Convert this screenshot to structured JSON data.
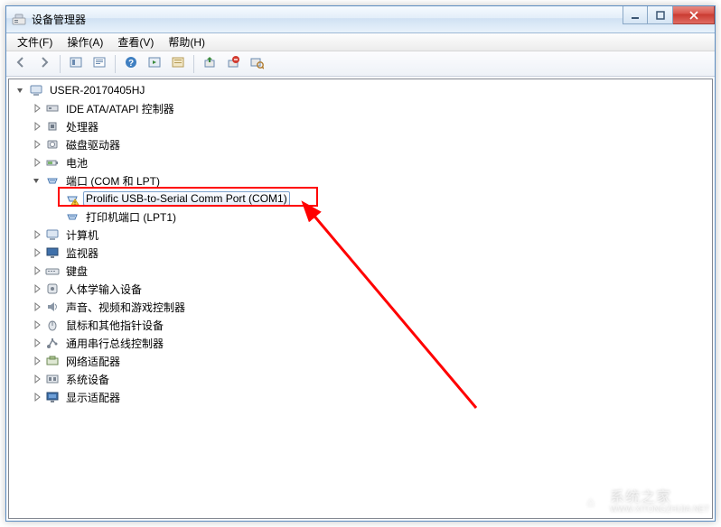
{
  "window": {
    "title": "设备管理器"
  },
  "menubar": {
    "file": "文件(F)",
    "action": "操作(A)",
    "view": "查看(V)",
    "help": "帮助(H)"
  },
  "toolbar_icons": {
    "back": "back-icon",
    "forward": "forward-icon",
    "show_hidden": "show-hidden-icon",
    "properties": "properties-icon",
    "help": "help-icon",
    "refresh": "refresh-icon",
    "action1": "action1-icon",
    "update_driver": "update-driver-icon",
    "uninstall": "uninstall-icon",
    "scan_hw": "scan-hardware-icon"
  },
  "tree": {
    "root": {
      "label": "USER-20170405HJ",
      "expanded": true
    },
    "items": [
      {
        "label": "IDE ATA/ATAPI 控制器",
        "expanded": false,
        "icon": "ide"
      },
      {
        "label": "处理器",
        "expanded": false,
        "icon": "cpu"
      },
      {
        "label": "磁盘驱动器",
        "expanded": false,
        "icon": "disk"
      },
      {
        "label": "电池",
        "expanded": false,
        "icon": "battery"
      },
      {
        "label": "端口 (COM 和 LPT)",
        "expanded": true,
        "icon": "port",
        "children": [
          {
            "label": "Prolific USB-to-Serial Comm Port (COM1)",
            "icon": "port_warn",
            "selected": true
          },
          {
            "label": "打印机端口 (LPT1)",
            "icon": "port"
          }
        ]
      },
      {
        "label": "计算机",
        "expanded": false,
        "icon": "computer"
      },
      {
        "label": "监视器",
        "expanded": false,
        "icon": "monitor"
      },
      {
        "label": "键盘",
        "expanded": false,
        "icon": "keyboard"
      },
      {
        "label": "人体学输入设备",
        "expanded": false,
        "icon": "hid"
      },
      {
        "label": "声音、视频和游戏控制器",
        "expanded": false,
        "icon": "audio"
      },
      {
        "label": "鼠标和其他指针设备",
        "expanded": false,
        "icon": "mouse"
      },
      {
        "label": "通用串行总线控制器",
        "expanded": false,
        "icon": "usb"
      },
      {
        "label": "网络适配器",
        "expanded": false,
        "icon": "net"
      },
      {
        "label": "系统设备",
        "expanded": false,
        "icon": "system"
      },
      {
        "label": "显示适配器",
        "expanded": false,
        "icon": "display"
      }
    ]
  },
  "annotation": {
    "highlight_color": "#ff0000"
  },
  "watermark": {
    "text_top": "系统之家",
    "text_bottom": "WWW.XITONGZHIJIA.NET"
  }
}
